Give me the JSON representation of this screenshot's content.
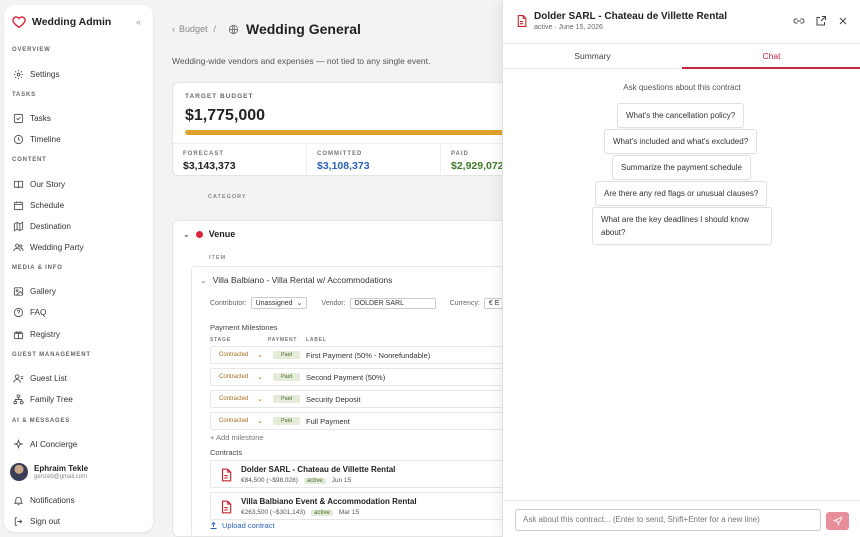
{
  "app": {
    "title": "Wedding Admin"
  },
  "sidebar": {
    "sections": [
      {
        "label": "OVERVIEW",
        "items": [
          {
            "label": "Settings",
            "icon": "gear-icon"
          }
        ]
      },
      {
        "label": "TASKS",
        "items": [
          {
            "label": "Tasks",
            "icon": "checkbox-icon"
          },
          {
            "label": "Timeline",
            "icon": "clock-icon"
          }
        ]
      },
      {
        "label": "CONTENT",
        "items": [
          {
            "label": "Our Story",
            "icon": "book-icon"
          },
          {
            "label": "Schedule",
            "icon": "calendar-icon"
          },
          {
            "label": "Destination",
            "icon": "map-icon"
          },
          {
            "label": "Wedding Party",
            "icon": "users-icon"
          }
        ]
      },
      {
        "label": "MEDIA & INFO",
        "items": [
          {
            "label": "Gallery",
            "icon": "image-icon"
          },
          {
            "label": "FAQ",
            "icon": "help-icon"
          },
          {
            "label": "Registry",
            "icon": "gift-icon"
          }
        ]
      },
      {
        "label": "GUEST MANAGEMENT",
        "items": [
          {
            "label": "Guest List",
            "icon": "user-list-icon"
          },
          {
            "label": "Family Tree",
            "icon": "tree-icon"
          }
        ]
      },
      {
        "label": "AI & MESSAGES",
        "items": [
          {
            "label": "AI Concierge",
            "icon": "sparkle-icon"
          }
        ]
      }
    ],
    "user": {
      "name": "Ephraim Tekle",
      "email": "genzeb@gmail.com"
    },
    "notifications": "Notifications",
    "sign_out": "Sign out"
  },
  "header": {
    "back_label": "Budget",
    "separator": "/",
    "title": "Wedding General",
    "subtitle": "Wedding-wide vendors and expenses — not tied to any single event."
  },
  "budget": {
    "target_label": "TARGET BUDGET",
    "target_value": "$1,775,000",
    "progress_fraction": 1.0,
    "progress_color": "#e0a12c",
    "stats": [
      {
        "label": "FORECAST",
        "value": "$3,143,373",
        "color": "#222222"
      },
      {
        "label": "COMMITTED",
        "value": "$3,108,373",
        "color": "#2b62b8"
      },
      {
        "label": "PAID",
        "value": "$2,929,072",
        "color": "#3f7a2a"
      }
    ]
  },
  "table": {
    "category_header": "CATEGORY",
    "category": {
      "name": "Venue",
      "color": "#d9263b"
    },
    "item_header": "ITEM",
    "item": {
      "title": "Villa Balbiano - Villa Rental w/ Accommodations",
      "contributor_label": "Contributor:",
      "contributor_value": "Unassigned",
      "vendor_label": "Vendor:",
      "vendor_value": "DOLDER SARL",
      "currency_label": "Currency:",
      "currency_value": "€ E",
      "milestones_title": "Payment Milestones",
      "columns": [
        "STAGE",
        "PAYMENT",
        "LABEL"
      ],
      "milestones": [
        {
          "stage": "Contracted",
          "payment": "Paid",
          "label": "First Payment (50% - Nonrefundable)"
        },
        {
          "stage": "Contracted",
          "payment": "Paid",
          "label": "Second Payment (50%)"
        },
        {
          "stage": "Contracted",
          "payment": "Paid",
          "label": "Security Deposit"
        },
        {
          "stage": "Contracted",
          "payment": "Paid",
          "label": "Full Payment"
        }
      ],
      "add_milestone": "+ Add milestone",
      "contracts_title": "Contracts",
      "contracts": [
        {
          "name": "Dolder SARL - Chateau de Villette Rental",
          "amount": "€84,500 (~$98,028)",
          "status": "active",
          "date": "Jun 15"
        },
        {
          "name": "Villa Balbiano Event & Accommodation Rental",
          "amount": "€263,500 (~$301,143)",
          "status": "active",
          "date": "Mar 15"
        }
      ],
      "upload_label": "Upload contract"
    }
  },
  "panel": {
    "title": "Dolder SARL - Chateau de Villette Rental",
    "subtitle": "active · June 15, 2026",
    "tabs": [
      {
        "label": "Summary",
        "active": false
      },
      {
        "label": "Chat",
        "active": true
      }
    ],
    "ask_title": "Ask questions about this contract",
    "suggestions": [
      "What's the cancellation policy?",
      "What's included and what's excluded?",
      "Summarize the payment schedule",
      "Are there any red flags or unusual clauses?",
      "What are the key deadlines I should know about?"
    ],
    "input_placeholder": "Ask about this contract... (Enter to send, Shift+Enter for a new line)",
    "accent": "#c0283d"
  }
}
